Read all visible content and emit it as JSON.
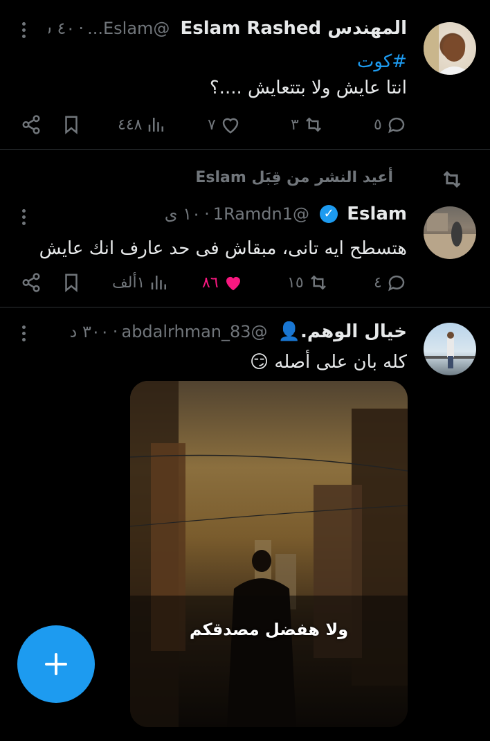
{
  "colors": {
    "accent": "#1d9bf0",
    "muted": "#71767b",
    "like": "#f91880",
    "bg": "#000000"
  },
  "tweets": [
    {
      "name": "المهندس Eslam Rashed",
      "handle": "@Eslam...",
      "time": "٤٠ س",
      "hashtag": "#كوت",
      "text": "انتا عايش ولا بتتعايش ....؟",
      "replies": "٥",
      "retweets": "٣",
      "likes": "٧",
      "views": "٤٤٨"
    },
    {
      "retweeted_by": "أعيد النشر من قِبَل Eslam",
      "name": "Eslam",
      "handle": "@1Ramdn1",
      "time": "١٠ ى",
      "text": "هتسطح ايه تانى، مبقاش فى حد عارف انك عايش",
      "replies": "٤",
      "retweets": "١٥",
      "likes": "٨٦",
      "views": "١ألف"
    },
    {
      "name": "خيال الوهم.👤",
      "handle": "@abdalrhman_83",
      "time": "٣٠٠ د",
      "text": "كله بان على أصله 😏",
      "media_caption": "ولا هفضل مصدقكم"
    }
  ]
}
